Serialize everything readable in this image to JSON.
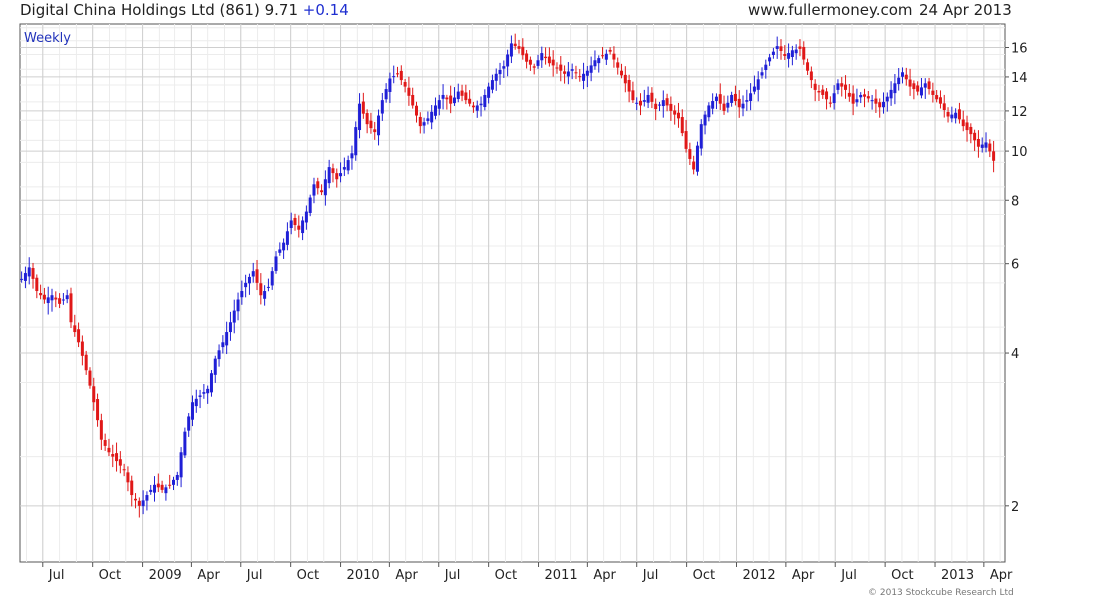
{
  "header": {
    "title": "Digital China Holdings Ltd (861)",
    "last": "9.71",
    "change": "+0.14",
    "site": "www.fullermoney.com",
    "date": "24 Apr 2013"
  },
  "frequency_label": "Weekly",
  "copyright": "© 2013 Stockcube Research Ltd",
  "colors": {
    "up": "#1f1fd6",
    "down": "#e01818",
    "grid": "#cfcfcf",
    "gridMinor": "#ececec",
    "change": "#1f2fd0"
  },
  "chart_data": {
    "type": "candlestick",
    "frequency": "weekly",
    "yscale": "log",
    "ylim": [
      1.55,
      17.8
    ],
    "yticks": [
      2,
      4,
      6,
      8,
      10,
      12,
      14,
      16
    ],
    "xlim": [
      "2008-05-20",
      "2013-05-10"
    ],
    "xticks": [
      {
        "date": "2008-07-01",
        "label": "Jul"
      },
      {
        "date": "2008-10-01",
        "label": "Oct"
      },
      {
        "date": "2009-01-01",
        "label": "2009"
      },
      {
        "date": "2009-04-01",
        "label": "Apr"
      },
      {
        "date": "2009-07-01",
        "label": "Jul"
      },
      {
        "date": "2009-10-01",
        "label": "Oct"
      },
      {
        "date": "2010-01-01",
        "label": "2010"
      },
      {
        "date": "2010-04-01",
        "label": "Apr"
      },
      {
        "date": "2010-07-01",
        "label": "Jul"
      },
      {
        "date": "2010-10-01",
        "label": "Oct"
      },
      {
        "date": "2011-01-01",
        "label": "2011"
      },
      {
        "date": "2011-04-01",
        "label": "Apr"
      },
      {
        "date": "2011-07-01",
        "label": "Jul"
      },
      {
        "date": "2011-10-01",
        "label": "Oct"
      },
      {
        "date": "2012-01-01",
        "label": "2012"
      },
      {
        "date": "2012-04-01",
        "label": "Apr"
      },
      {
        "date": "2012-07-01",
        "label": "Jul"
      },
      {
        "date": "2012-10-01",
        "label": "Oct"
      },
      {
        "date": "2013-01-01",
        "label": "2013"
      },
      {
        "date": "2013-04-01",
        "label": "Apr"
      }
    ],
    "close_series": [
      [
        "2008-05-23",
        5.6
      ],
      [
        "2008-06-06",
        5.9
      ],
      [
        "2008-06-20",
        5.3
      ],
      [
        "2008-07-04",
        5.1
      ],
      [
        "2008-07-18",
        5.2
      ],
      [
        "2008-08-01",
        5.0
      ],
      [
        "2008-08-15",
        5.2
      ],
      [
        "2008-08-22",
        4.6
      ],
      [
        "2008-09-05",
        4.2
      ],
      [
        "2008-09-19",
        3.7
      ],
      [
        "2008-10-03",
        3.2
      ],
      [
        "2008-10-17",
        2.7
      ],
      [
        "2008-10-31",
        2.55
      ],
      [
        "2008-11-14",
        2.45
      ],
      [
        "2008-11-28",
        2.35
      ],
      [
        "2008-12-12",
        2.1
      ],
      [
        "2008-12-26",
        2.0
      ],
      [
        "2009-01-09",
        2.1
      ],
      [
        "2009-01-23",
        2.2
      ],
      [
        "2009-02-06",
        2.15
      ],
      [
        "2009-02-20",
        2.2
      ],
      [
        "2009-03-06",
        2.3
      ],
      [
        "2009-03-20",
        2.8
      ],
      [
        "2009-04-03",
        3.2
      ],
      [
        "2009-04-17",
        3.3
      ],
      [
        "2009-05-01",
        3.4
      ],
      [
        "2009-05-15",
        3.9
      ],
      [
        "2009-05-29",
        4.2
      ],
      [
        "2009-06-12",
        4.6
      ],
      [
        "2009-06-26",
        5.1
      ],
      [
        "2009-07-10",
        5.5
      ],
      [
        "2009-07-24",
        5.8
      ],
      [
        "2009-08-07",
        5.2
      ],
      [
        "2009-08-21",
        5.4
      ],
      [
        "2009-09-04",
        6.2
      ],
      [
        "2009-09-18",
        6.6
      ],
      [
        "2009-10-02",
        7.3
      ],
      [
        "2009-10-16",
        7.0
      ],
      [
        "2009-10-30",
        7.6
      ],
      [
        "2009-11-13",
        8.6
      ],
      [
        "2009-11-27",
        8.3
      ],
      [
        "2009-12-11",
        9.3
      ],
      [
        "2009-12-25",
        8.8
      ],
      [
        "2010-01-08",
        9.3
      ],
      [
        "2010-01-22",
        9.9
      ],
      [
        "2010-02-05",
        12.4
      ],
      [
        "2010-02-19",
        11.3
      ],
      [
        "2010-03-05",
        10.9
      ],
      [
        "2010-03-19",
        12.6
      ],
      [
        "2010-04-02",
        13.9
      ],
      [
        "2010-04-16",
        14.2
      ],
      [
        "2010-04-30",
        13.4
      ],
      [
        "2010-05-14",
        12.3
      ],
      [
        "2010-05-28",
        11.2
      ],
      [
        "2010-06-11",
        11.6
      ],
      [
        "2010-06-25",
        12.3
      ],
      [
        "2010-07-09",
        12.9
      ],
      [
        "2010-07-23",
        12.4
      ],
      [
        "2010-08-06",
        13.1
      ],
      [
        "2010-08-20",
        12.6
      ],
      [
        "2010-09-03",
        12.2
      ],
      [
        "2010-09-17",
        12.4
      ],
      [
        "2010-10-01",
        13.4
      ],
      [
        "2010-10-15",
        14.2
      ],
      [
        "2010-10-29",
        14.7
      ],
      [
        "2010-11-12",
        16.3
      ],
      [
        "2010-11-26",
        15.9
      ],
      [
        "2010-12-10",
        15.0
      ],
      [
        "2010-12-24",
        14.6
      ],
      [
        "2011-01-07",
        15.6
      ],
      [
        "2011-01-21",
        14.9
      ],
      [
        "2011-02-04",
        14.6
      ],
      [
        "2011-02-18",
        14.2
      ],
      [
        "2011-03-04",
        14.5
      ],
      [
        "2011-03-18",
        14.0
      ],
      [
        "2011-04-01",
        14.4
      ],
      [
        "2011-04-15",
        15.1
      ],
      [
        "2011-04-29",
        15.4
      ],
      [
        "2011-05-13",
        15.7
      ],
      [
        "2011-05-27",
        14.6
      ],
      [
        "2011-06-10",
        13.6
      ],
      [
        "2011-06-24",
        12.6
      ],
      [
        "2011-07-08",
        12.3
      ],
      [
        "2011-07-22",
        12.9
      ],
      [
        "2011-08-05",
        12.1
      ],
      [
        "2011-08-19",
        12.6
      ],
      [
        "2011-09-02",
        12.0
      ],
      [
        "2011-09-16",
        11.6
      ],
      [
        "2011-09-30",
        10.1
      ],
      [
        "2011-10-14",
        9.2
      ],
      [
        "2011-10-28",
        11.3
      ],
      [
        "2011-11-11",
        12.3
      ],
      [
        "2011-11-25",
        12.8
      ],
      [
        "2011-12-09",
        12.0
      ],
      [
        "2011-12-23",
        12.9
      ],
      [
        "2012-01-06",
        12.2
      ],
      [
        "2012-01-20",
        12.6
      ],
      [
        "2012-02-03",
        13.4
      ],
      [
        "2012-02-17",
        14.3
      ],
      [
        "2012-03-02",
        15.3
      ],
      [
        "2012-03-16",
        16.1
      ],
      [
        "2012-03-30",
        15.4
      ],
      [
        "2012-04-13",
        15.8
      ],
      [
        "2012-04-27",
        15.9
      ],
      [
        "2012-05-11",
        14.4
      ],
      [
        "2012-05-25",
        13.2
      ],
      [
        "2012-06-08",
        12.9
      ],
      [
        "2012-06-22",
        12.4
      ],
      [
        "2012-07-06",
        13.6
      ],
      [
        "2012-07-20",
        13.2
      ],
      [
        "2012-08-03",
        12.4
      ],
      [
        "2012-08-17",
        12.9
      ],
      [
        "2012-09-07",
        12.6
      ],
      [
        "2012-09-21",
        12.2
      ],
      [
        "2012-10-05",
        12.8
      ],
      [
        "2012-10-19",
        13.6
      ],
      [
        "2012-11-02",
        14.3
      ],
      [
        "2012-11-16",
        13.4
      ],
      [
        "2012-11-30",
        13.1
      ],
      [
        "2012-12-14",
        13.6
      ],
      [
        "2012-12-28",
        12.9
      ],
      [
        "2013-01-11",
        12.4
      ],
      [
        "2013-01-25",
        11.7
      ],
      [
        "2013-02-08",
        11.9
      ],
      [
        "2013-02-22",
        11.2
      ],
      [
        "2013-03-08",
        10.8
      ],
      [
        "2013-03-22",
        10.2
      ],
      [
        "2013-04-05",
        10.4
      ],
      [
        "2013-04-19",
        9.57
      ],
      [
        "2013-04-24",
        9.71
      ]
    ]
  }
}
